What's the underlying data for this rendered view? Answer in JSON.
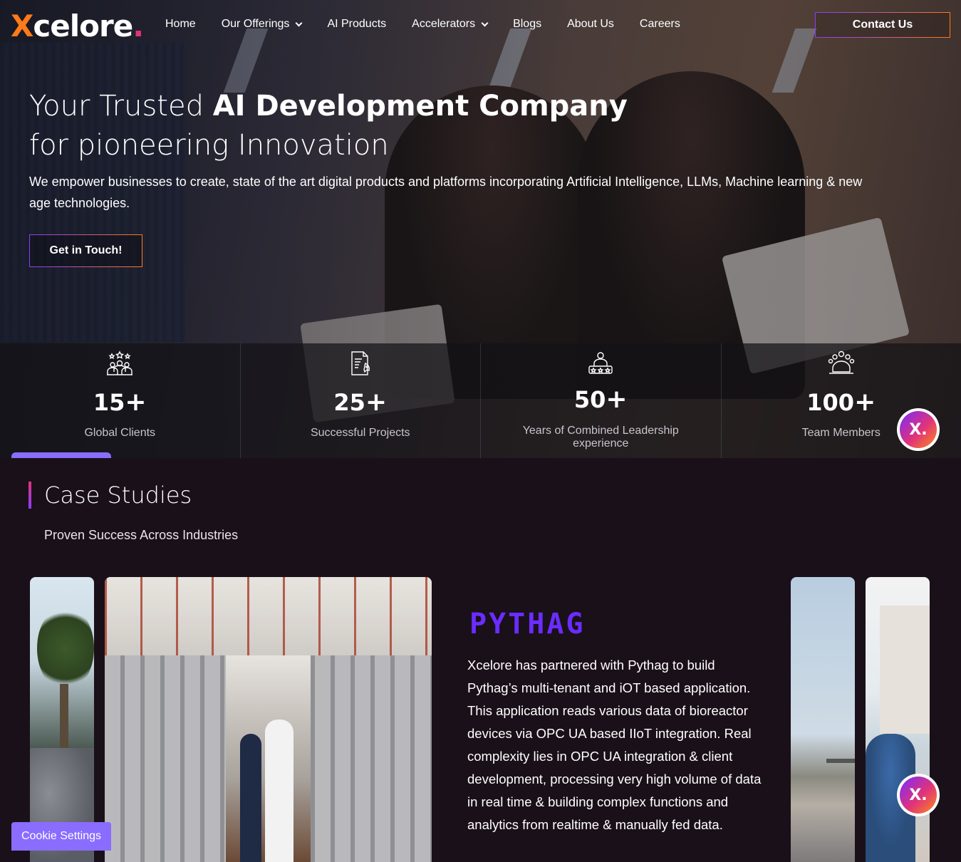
{
  "nav": {
    "logo": {
      "x": "X",
      "rest": "celore",
      "dot": "."
    },
    "items": [
      {
        "label": "Home",
        "dropdown": false
      },
      {
        "label": "Our Offerings",
        "dropdown": true
      },
      {
        "label": "AI Products",
        "dropdown": false
      },
      {
        "label": "Accelerators",
        "dropdown": true
      },
      {
        "label": "Blogs",
        "dropdown": false
      },
      {
        "label": "About Us",
        "dropdown": false
      },
      {
        "label": "Careers",
        "dropdown": false
      }
    ],
    "contact_label": "Contact Us"
  },
  "hero": {
    "title_pre": "Your Trusted ",
    "title_bold": "AI Development Company",
    "title_line2": "for pioneering Innovation",
    "subtitle": "We empower businesses to create, state of the art digital products and platforms incorporating Artificial Intelligence, LLMs, Machine learning & new age technologies.",
    "cta_label": "Get in Touch!"
  },
  "stats": [
    {
      "icon": "clients-icon",
      "number": "15",
      "plus": "+",
      "label": "Global Clients"
    },
    {
      "icon": "projects-icon",
      "number": "25",
      "plus": "+",
      "label": "Successful Projects"
    },
    {
      "icon": "leadership-icon",
      "number": "50",
      "plus": "+",
      "label": "Years of Combined Leadership experience"
    },
    {
      "icon": "team-icon",
      "number": "100",
      "plus": "+",
      "label": "Team Members"
    }
  ],
  "badge": {
    "label": "X."
  },
  "case_studies": {
    "title": "Case Studies",
    "subtitle": "Proven Success Across Industries",
    "active": {
      "brand": "PYTHAG",
      "description": "Xcelore has partnered with Pythag to build Pythag’s multi-tenant and iOT based application. This application reads various data of bioreactor devices via OPC UA based IIoT integration. Real complexity lies in OPC UA integration & client development, processing very high volume of data in real time & building complex functions and analytics from realtime & manually fed data."
    }
  },
  "cookie_label": "Cookie Settings",
  "colors": {
    "accent_purple": "#8a6cff",
    "brand_purple": "#6a2cff",
    "brand_orange": "#ff7a1a",
    "brand_pink": "#e0337a",
    "page_bg": "#1a1019"
  }
}
